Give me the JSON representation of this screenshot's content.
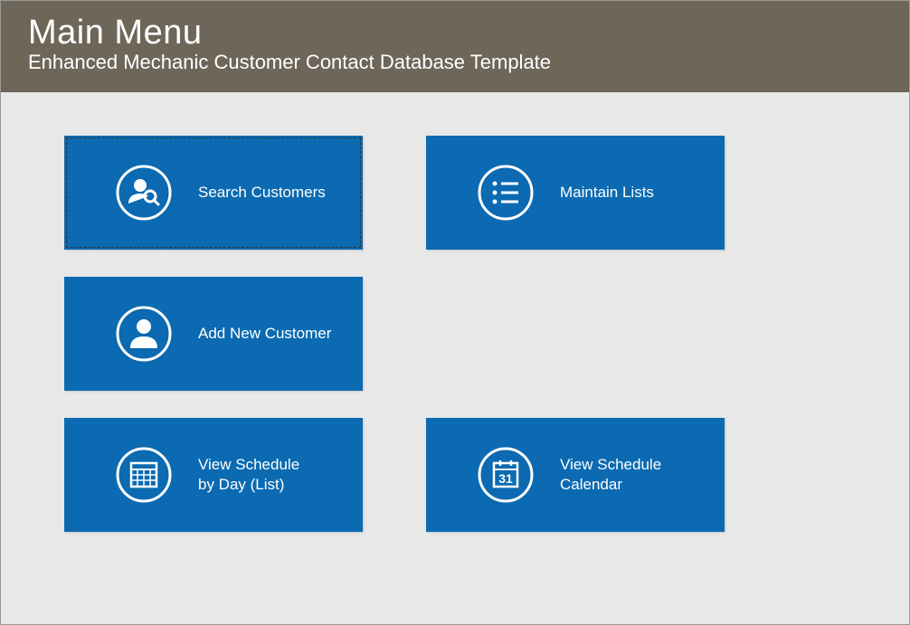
{
  "header": {
    "title": "Main Menu",
    "subtitle": "Enhanced Mechanic Customer Contact Database Template"
  },
  "tiles": {
    "searchCustomers": {
      "label": "Search Customers"
    },
    "maintainLists": {
      "label": "Maintain Lists"
    },
    "addNewCustomer": {
      "label": "Add New Customer"
    },
    "viewScheduleByDay": {
      "label": "View Schedule\nby Day (List)"
    },
    "viewScheduleCalendar": {
      "label": "View Schedule\nCalendar"
    }
  },
  "colors": {
    "headerBg": "#6d6659",
    "tileBg": "#0b6ab1",
    "pageBg": "#e8e8e8"
  }
}
